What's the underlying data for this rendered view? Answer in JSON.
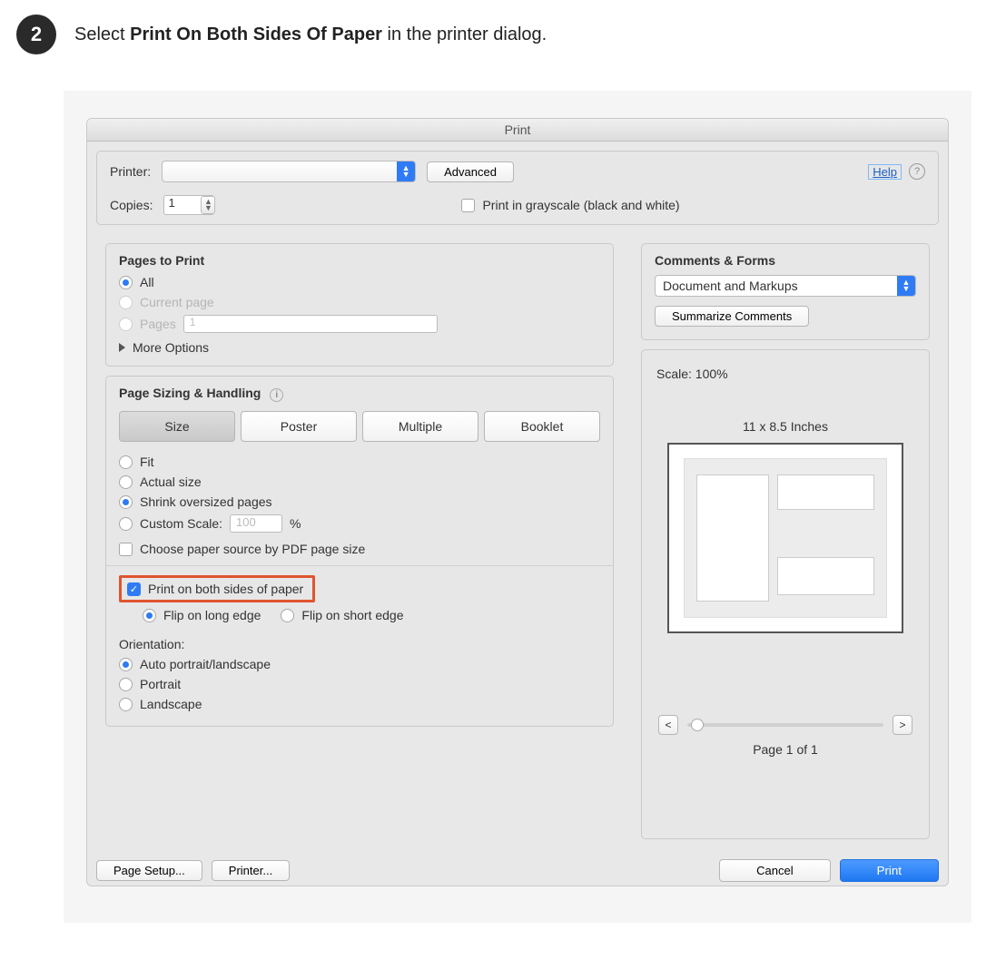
{
  "step": {
    "number": "2",
    "prefix": "Select ",
    "bold": "Print On Both Sides Of Paper",
    "suffix": " in the printer dialog."
  },
  "dialog": {
    "title": "Print",
    "printer_label": "Printer:",
    "advanced_btn": "Advanced",
    "help_link": "Help",
    "copies_label": "Copies:",
    "copies_value": "1",
    "grayscale_label": "Print in grayscale (black and white)"
  },
  "pages_to_print": {
    "title": "Pages to Print",
    "all": "All",
    "current": "Current page",
    "pages": "Pages",
    "pages_value": "1",
    "more_options": "More Options"
  },
  "sizing": {
    "title": "Page Sizing & Handling",
    "seg": {
      "size": "Size",
      "poster": "Poster",
      "multiple": "Multiple",
      "booklet": "Booklet"
    },
    "fit": "Fit",
    "actual": "Actual size",
    "shrink": "Shrink oversized pages",
    "custom": "Custom Scale:",
    "custom_value": "100",
    "percent": "%",
    "choose_source": "Choose paper source by PDF page size"
  },
  "duplex": {
    "both_sides": "Print on both sides of paper",
    "long_edge": "Flip on long edge",
    "short_edge": "Flip on short edge"
  },
  "orientation": {
    "title": "Orientation:",
    "auto": "Auto portrait/landscape",
    "portrait": "Portrait",
    "landscape": "Landscape"
  },
  "comments_forms": {
    "title": "Comments & Forms",
    "select_value": "Document and Markups",
    "summarize_btn": "Summarize Comments"
  },
  "preview": {
    "scale": "Scale: 100%",
    "dimensions": "11 x 8.5 Inches",
    "page_of": "Page 1 of 1",
    "prev": "<",
    "next": ">"
  },
  "footer": {
    "page_setup": "Page Setup...",
    "printer_btn": "Printer...",
    "cancel": "Cancel",
    "print": "Print"
  }
}
